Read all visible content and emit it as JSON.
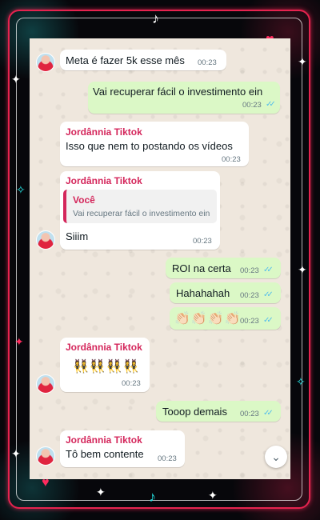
{
  "messages": [
    {
      "text": "Meta é fazer 5k esse mês",
      "time": "00:23"
    },
    {
      "text": "Vai recuperar fácil o investimento ein",
      "time": "00:23"
    },
    {
      "sender": "Jordânnia Tiktok",
      "text": "Isso que nem to postando os vídeos",
      "time": "00:23"
    },
    {
      "sender": "Jordânnia Tiktok",
      "quote_author": "Você",
      "quote_text": "Vai recuperar fácil o investimento ein",
      "text": "Siiim",
      "time": "00:23"
    },
    {
      "text": "ROI na certa",
      "time": "00:23"
    },
    {
      "text": "Hahahahah",
      "time": "00:23"
    },
    {
      "emoji": "👏🏻👏🏻👏🏻👏🏻",
      "time": "00:23"
    },
    {
      "sender": "Jordânnia Tiktok",
      "emoji": "👯‍♀️👯‍♀️👯‍♀️👯‍♀️",
      "time": "00:23"
    },
    {
      "text": "Tooop demais",
      "time": "00:23"
    },
    {
      "sender": "Jordânnia Tiktok",
      "text": "Tô bem contente",
      "time": "00:23"
    }
  ],
  "read_tick": "✓✓",
  "scroll_icon": "⌄",
  "colors": {
    "sender": "#d4265b",
    "outgoing": "#dbf8c6",
    "incoming": "#ffffff",
    "tick": "#53bdeb"
  }
}
